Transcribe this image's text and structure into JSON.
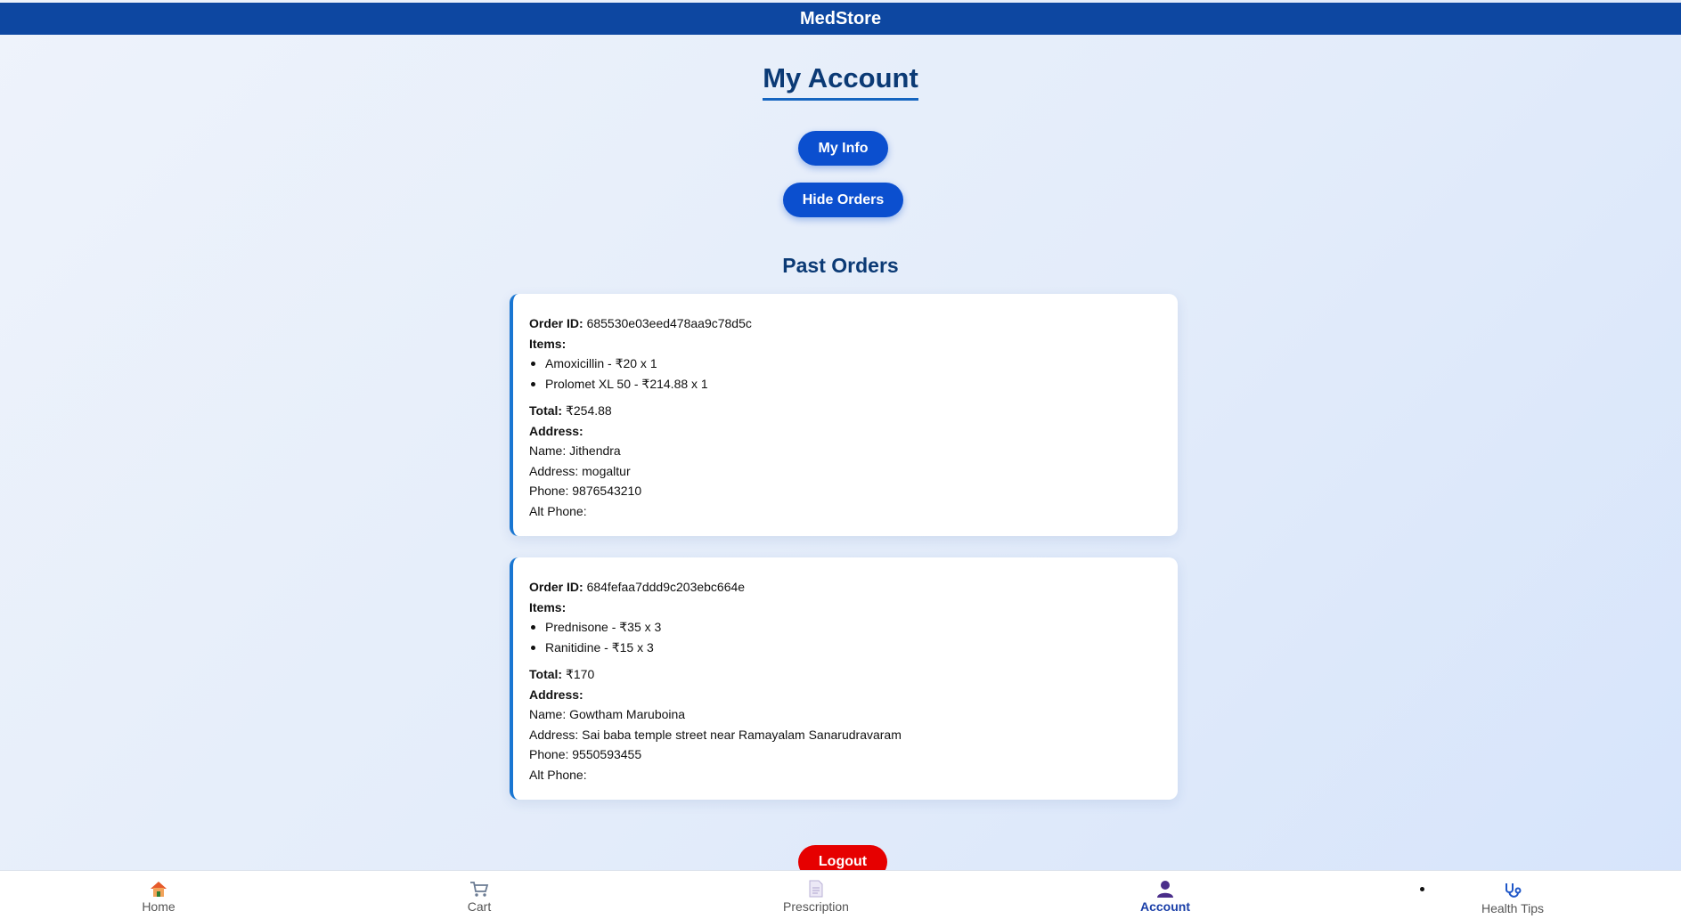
{
  "header": {
    "brand": "MedStore"
  },
  "page": {
    "title": "My Account"
  },
  "buttons": {
    "my_info": "My Info",
    "hide_orders": "Hide Orders",
    "logout": "Logout"
  },
  "orders_section": {
    "title": "Past Orders"
  },
  "labels": {
    "order_id": "Order ID:",
    "items": "Items:",
    "total": "Total:",
    "address": "Address:"
  },
  "orders": [
    {
      "order_id": "685530e03eed478aa9c78d5c",
      "items": [
        "Amoxicillin - ₹20 x 1",
        "Prolomet XL 50 - ₹214.88 x 1"
      ],
      "total": "₹254.88",
      "name_line": "Name: Jithendra",
      "address_line": "Address: mogaltur",
      "phone_line": "Phone: 9876543210",
      "alt_phone_line": "Alt Phone:"
    },
    {
      "order_id": "684fefaa7ddd9c203ebc664e",
      "items": [
        "Prednisone - ₹35 x 3",
        "Ranitidine - ₹15 x 3"
      ],
      "total": "₹170",
      "name_line": "Name: Gowtham Maruboina",
      "address_line": "Address: Sai baba temple street near Ramayalam Sanarudravaram",
      "phone_line": "Phone: 9550593455",
      "alt_phone_line": "Alt Phone:"
    }
  ],
  "nav": {
    "home": "Home",
    "cart": "Cart",
    "prescription": "Prescription",
    "account": "Account",
    "health_tips": "Health Tips",
    "active": "account",
    "icons": [
      "home-icon",
      "cart-icon",
      "prescription-icon",
      "account-icon",
      "stethoscope-icon"
    ]
  },
  "colors": {
    "header_bg": "#0d47a1",
    "primary_button": "#0b4fcf",
    "logout_button": "#e60000",
    "title_text": "#0b3a75",
    "card_accent": "#1976d2",
    "active_nav": "#1a3fa8"
  }
}
